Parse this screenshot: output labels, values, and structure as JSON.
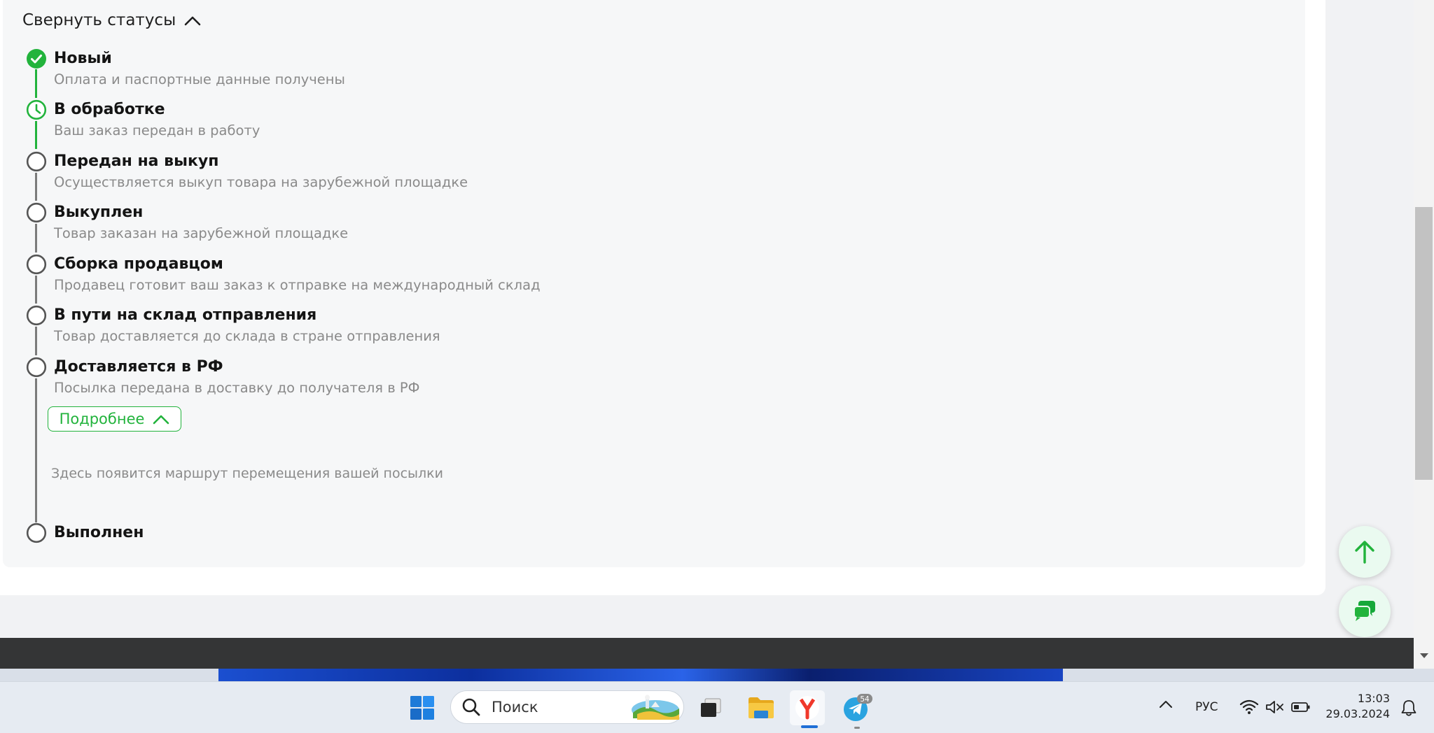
{
  "statuses": {
    "collapse_label": "Свернуть статусы",
    "steps": [
      {
        "title": "Новый",
        "description": "Оплата и паспортные данные получены",
        "state": "done"
      },
      {
        "title": "В обработке",
        "description": "Ваш заказ передан в работу",
        "state": "current"
      },
      {
        "title": "Передан на выкуп",
        "description": "Осуществляется выкуп товара на зарубежной площадке",
        "state": "pending"
      },
      {
        "title": "Выкуплен",
        "description": "Товар заказан на зарубежной площадке",
        "state": "pending"
      },
      {
        "title": "Сборка продавцом",
        "description": "Продавец готовит ваш заказ к отправке на международный склад",
        "state": "pending"
      },
      {
        "title": "В пути на склад отправления",
        "description": "Товар доставляется до склада в стране отправления",
        "state": "pending"
      },
      {
        "title": "Доставляется в РФ",
        "description": "Посылка передана в доставку до получателя в РФ",
        "state": "pending"
      },
      {
        "title": "Выполнен",
        "description": "",
        "state": "pending"
      }
    ],
    "more_label": "Подробнее",
    "route_placeholder": "Здесь появится маршрут перемещения вашей посылки"
  },
  "colors": {
    "accent": "#22b33c",
    "pending_marker": "#555555",
    "footer": "#343536"
  },
  "taskbar": {
    "search_placeholder": "Поиск",
    "telegram_badge": "54",
    "language": "РУС",
    "time": "13:03",
    "date": "29.03.2024"
  }
}
